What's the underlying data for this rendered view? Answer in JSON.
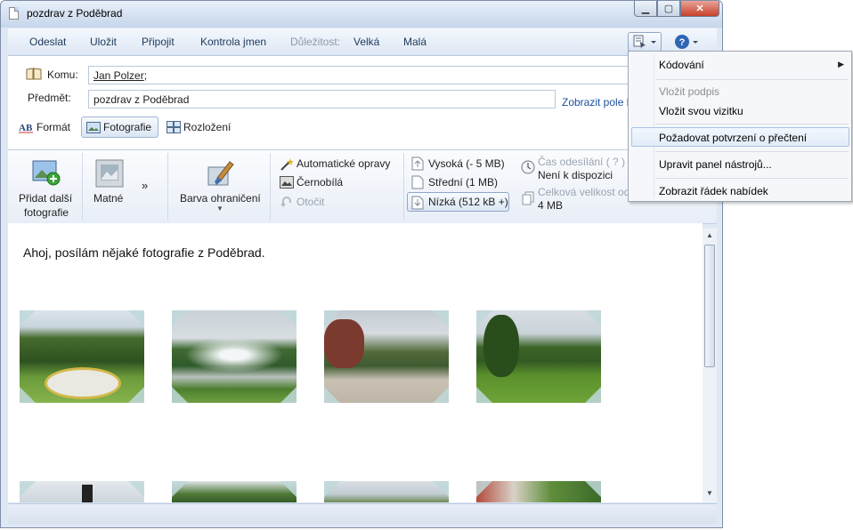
{
  "window": {
    "title": "pozdrav z Poděbrad"
  },
  "toolbar": {
    "send": "Odeslat",
    "save": "Uložit",
    "attach": "Připojit",
    "check_names": "Kontrola jmen",
    "importance_label": "Důležitost:",
    "high": "Velká",
    "low": "Malá"
  },
  "header": {
    "to_label": "Komu:",
    "to_value": "Jan Polzer",
    "to_suffix": ";",
    "subject_label": "Předmět:",
    "subject_value": "pozdrav z Poděbrad",
    "show_fields": "Zobrazit pole k"
  },
  "tabs": {
    "format": "Formát",
    "photos": "Fotografie",
    "layout": "Rozložení"
  },
  "ribbon": {
    "add_photos_1": "Přidat další",
    "add_photos_2": "fotografie",
    "matte": "Matné",
    "more": "»",
    "border_color": "Barva ohraničení",
    "auto_fix": "Automatické opravy",
    "bw": "Černobílá",
    "rotate": "Otočit",
    "size_high": "Vysoká (- 5 MB)",
    "size_mid": "Střední (1 MB)",
    "size_low": "Nízká (512 kB +)",
    "send_time_label": "Čas odesílání ( ? )",
    "send_time_value": "Není k dispozici",
    "total_size_label": "Celková velikost od",
    "total_size_value": "4 MB"
  },
  "body": {
    "text": "Ahoj, posílám nějaké fotografie z Poděbrad."
  },
  "menu": {
    "encoding": "Kódování",
    "insert_signature": "Vložit podpis",
    "insert_card": "Vložit svou vizitku",
    "read_receipt": "Požadovat potvrzení o přečtení",
    "customize_toolbar": "Upravit panel nástrojů...",
    "show_menu_bar": "Zobrazit řádek nabídek"
  },
  "colors": {
    "accent": "#1e395b",
    "link": "#1e4f9e",
    "window_frame": "#dfe8f4",
    "menu_highlight": "#e1ecf9"
  }
}
